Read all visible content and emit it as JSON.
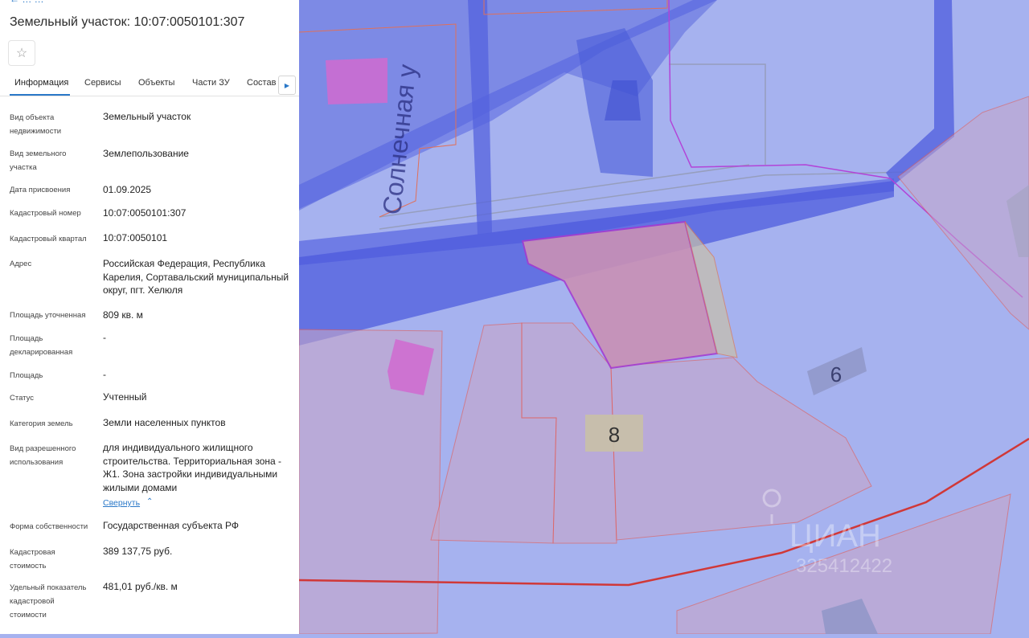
{
  "panel": {
    "breadcrumb": "← … …",
    "title": "Земельный участок: 10:07:0050101:307",
    "tabs": [
      {
        "label": "Информация"
      },
      {
        "label": "Сервисы"
      },
      {
        "label": "Объекты"
      },
      {
        "label": "Части ЗУ"
      },
      {
        "label": "Состав"
      }
    ],
    "fields": [
      {
        "label": "Вид объекта недвижимости",
        "value": "Земельный участок"
      },
      {
        "label": "Вид земельного участка",
        "value": "Землепользование"
      },
      {
        "label": "Дата присвоения",
        "value": "01.09.2025"
      },
      {
        "label": "Кадастровый номер",
        "value": "10:07:0050101:307"
      },
      {
        "label": "Кадастровый квартал",
        "value": "10:07:0050101"
      },
      {
        "label": "Адрес",
        "value": "Российская Федерация, Республика Карелия, Сортавальский муниципальный округ, пгт. Хелюля"
      },
      {
        "label": "Площадь уточненная",
        "value": "809 кв. м"
      },
      {
        "label": "Площадь декларированная",
        "value": "-"
      },
      {
        "label": "Площадь",
        "value": "-"
      },
      {
        "label": "Статус",
        "value": "Учтенный"
      },
      {
        "label": "Категория земель",
        "value": "Земли населенных пунктов"
      },
      {
        "label": "Вид разрешенного использования",
        "value": "для индивидуального жилищного строительства. Территориальная зона - Ж1. Зона застройки индивидуальными жилыми домами"
      },
      {
        "label": "Форма собственности",
        "value": "Государственная субъекта РФ"
      },
      {
        "label": "Кадастровая стоимость",
        "value": "389 137,75 руб."
      },
      {
        "label": "Удельный показатель кадастровой стоимости",
        "value": "481,01 руб./кв. м"
      }
    ],
    "collapse_label": "Свернуть"
  },
  "map": {
    "street_label": "Солнечная у",
    "house_numbers": [
      "8",
      "6"
    ],
    "watermark_brand": "ЦИАН",
    "watermark_id": "325412422"
  },
  "icons": {
    "favorite": "star-icon",
    "tabs_scroll": "triangle-right-icon",
    "collapse": "chevron-up-icon",
    "watermark_logo": "location-pin-icon"
  },
  "colors": {
    "accent": "#2a78c8",
    "map_background": "#a6b2ef",
    "road": "#5060d8",
    "selected_parcel": "#c990b5",
    "parcel_border": "#e85a50",
    "building": "#d06ad0",
    "boundary_line": "#d03838"
  }
}
